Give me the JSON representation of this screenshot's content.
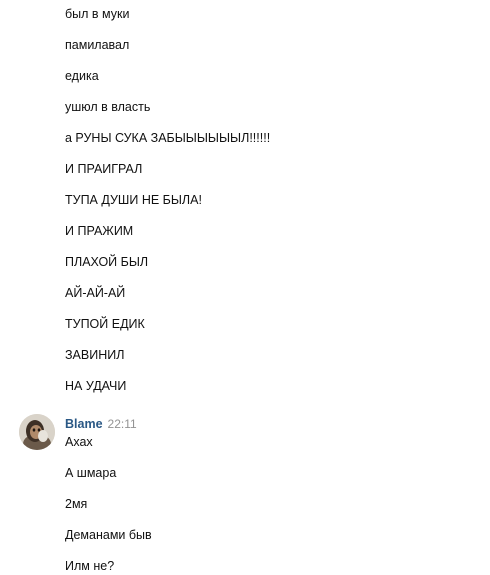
{
  "messages_before": [
    {
      "text": "был в муки"
    },
    {
      "text": "памилавал"
    },
    {
      "text": "едика"
    },
    {
      "text": "ушюл в власть"
    },
    {
      "text": "а РУНЫ СУКА ЗАБЫЫЫЫЫЫЛ!!!!!!"
    },
    {
      "text": "И ПРАИГРАЛ"
    },
    {
      "text": "ТУПА ДУШИ НЕ БЫЛА!"
    },
    {
      "text": "И ПРАЖИМ"
    },
    {
      "text": "ПЛАХОЙ БЫЛ"
    },
    {
      "text": "АЙ-АЙ-АЙ"
    },
    {
      "text": "ТУПОЙ ЕДИК"
    },
    {
      "text": "ЗАВИНИЛ"
    },
    {
      "text": "НА УДАЧИ"
    }
  ],
  "sender": {
    "name": "Blame",
    "time": "22:11",
    "avatar_icon": "user-avatar-photo"
  },
  "messages_after": [
    {
      "text": "Ахах"
    },
    {
      "text": "А шмара"
    },
    {
      "text": "2мя"
    },
    {
      "text": "Деманами быв"
    },
    {
      "text": "Илм не?"
    }
  ],
  "colors": {
    "sender_name": "#2a5885",
    "time": "#939393",
    "text": "#111111",
    "background": "#ffffff"
  }
}
